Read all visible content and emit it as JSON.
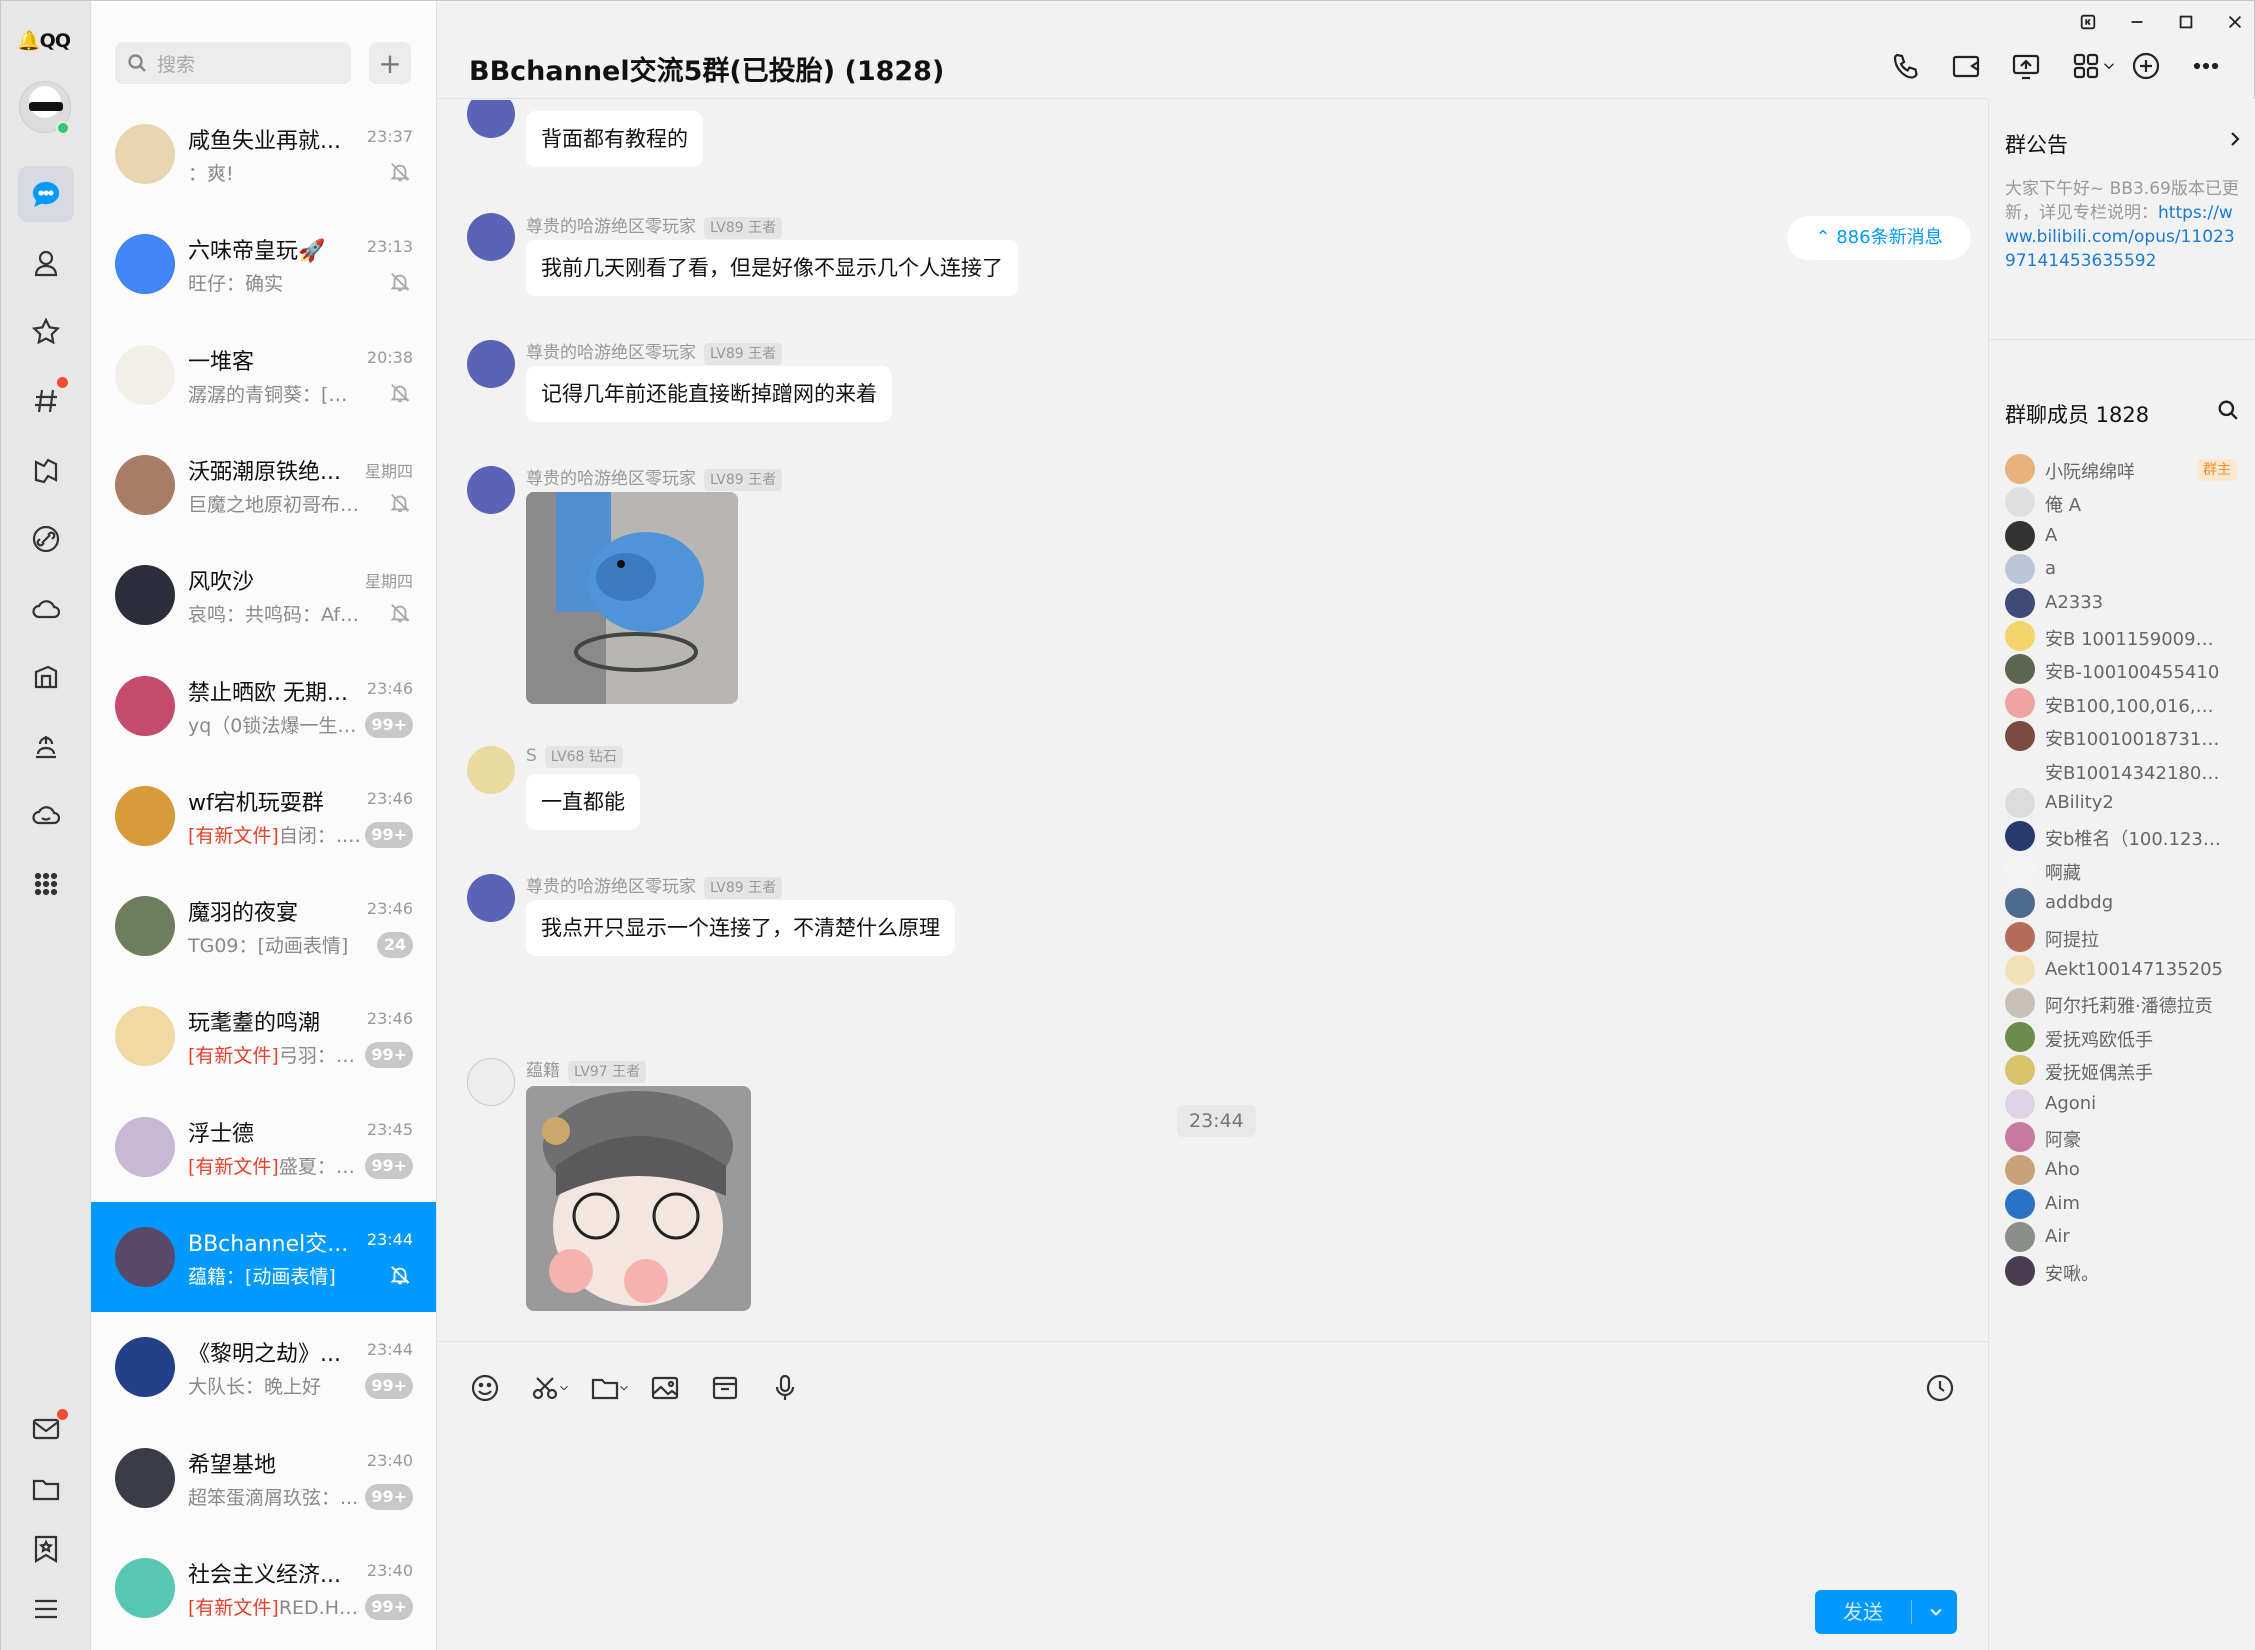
{
  "app": {
    "logo_text": "QQ"
  },
  "window_controls": [
    "pin-icon",
    "minimize-icon",
    "maximize-icon",
    "close-icon"
  ],
  "rail": {
    "items": [
      {
        "name": "chat-icon",
        "active": true
      },
      {
        "name": "contacts-icon"
      },
      {
        "name": "star-icon"
      },
      {
        "name": "channel-icon",
        "dot": true
      },
      {
        "name": "game-icon"
      },
      {
        "name": "link-icon"
      },
      {
        "name": "cloud-icon"
      },
      {
        "name": "bag-icon"
      },
      {
        "name": "music-icon"
      },
      {
        "name": "cloud-storage-icon"
      },
      {
        "name": "apps-grid-icon"
      }
    ],
    "bottom": [
      {
        "name": "mail-icon",
        "dot": true
      },
      {
        "name": "folder-icon"
      },
      {
        "name": "bookmark-icon"
      },
      {
        "name": "menu-icon"
      }
    ]
  },
  "search": {
    "placeholder": "搜索"
  },
  "conversations": [
    {
      "name": "咸鱼失业再就...",
      "time": "23:37",
      "preview": "：爽!",
      "muted": true,
      "avatar_color": "#e9d6b0"
    },
    {
      "name": "六味帝皇玩🚀",
      "time": "23:13",
      "preview": "旺仔：确实",
      "muted": true,
      "avatar_color": "#4285f4"
    },
    {
      "name": "一堆客",
      "time": "20:38",
      "preview": "潺潺的青铜葵：[图片]",
      "muted": true,
      "avatar_color": "#f1efe8"
    },
    {
      "name": "沃弼潮原铁绝...",
      "time": "星期四",
      "preview": "巨魔之地原初哥布林：...",
      "muted": true,
      "avatar_color": "#a87c65"
    },
    {
      "name": "风吹沙",
      "time": "星期四",
      "preview": "哀鸣：共鸣码：AfQiJA...",
      "muted": true,
      "avatar_color": "#2b2d3a"
    },
    {
      "name": "禁止晒欧  无期...",
      "time": "23:46",
      "preview": "yq（0锁法爆一生黑...",
      "badge": "99+",
      "avatar_color": "#c44b6b"
    },
    {
      "name": "wf宕机玩耍群",
      "time": "23:46",
      "tag": "[有新文件]",
      "preview": "自闭：.指...",
      "badge": "99+",
      "avatar_color": "#d99a3b"
    },
    {
      "name": "魔羽的夜宴",
      "time": "23:46",
      "preview": "TG09：[动画表情]",
      "badge": "24",
      "avatar_color": "#6d7d5e"
    },
    {
      "name": "玩耄耋的鸣潮",
      "time": "23:46",
      "tag": "[有新文件]",
      "preview": "弓羽：有...",
      "badge": "99+",
      "avatar_color": "#f0d9a2"
    },
    {
      "name": "浮士德",
      "time": "23:45",
      "tag": "[有新文件]",
      "preview": "盛夏：雀氏",
      "badge": "99+",
      "avatar_color": "#c9b7d6"
    },
    {
      "name": "BBchannel交...",
      "time": "23:44",
      "preview": "蕴籍：[动画表情]",
      "muted": true,
      "selected": true,
      "avatar_color": "#58496b"
    },
    {
      "name": "《黎明之劫》...",
      "time": "23:44",
      "preview": "大队长：晚上好",
      "badge": "99+",
      "avatar_color": "#23408a"
    },
    {
      "name": "希望基地",
      "time": "23:40",
      "preview": "超笨蛋滴屑玖弦：...",
      "badge": "99+",
      "avatar_color": "#3a3d48"
    },
    {
      "name": "社会主义经济...",
      "time": "23:40",
      "tag": "[有新文件]",
      "preview": "RED.HDL...",
      "badge": "99+",
      "avatar_color": "#58c6b5"
    }
  ],
  "chat": {
    "title": "BBchannel交流5群(已投胎) (1828)",
    "header_icons": [
      "phone-icon",
      "video-icon",
      "screen-share-icon",
      "apps-icon",
      "add-member-icon",
      "more-icon"
    ],
    "new_messages": "886条新消息",
    "messages": [
      {
        "sender": "",
        "level": "",
        "text": "背面都有教程的",
        "avatar_color": "#5a63b8"
      },
      {
        "sender": "尊贵的哈游绝区零玩家",
        "level": "LV89 王者",
        "text": "我前几天刚看了看，但是好像不显示几个人连接了",
        "avatar_color": "#5a63b8"
      },
      {
        "sender": "尊贵的哈游绝区零玩家",
        "level": "LV89 王者",
        "text": "记得几年前还能直接断掉蹭网的来着",
        "avatar_color": "#5a63b8"
      },
      {
        "sender": "尊贵的哈游绝区零玩家",
        "level": "LV89 王者",
        "image": "blue-plush-photo",
        "avatar_color": "#5a63b8"
      },
      {
        "sender": "S",
        "level": "LV68 钻石",
        "text": "一直都能",
        "avatar_color": "#e9dba0"
      },
      {
        "sender": "尊贵的哈游绝区零玩家",
        "level": "LV89 王者",
        "text": "我点开只显示一个连接了，不清楚什么原理",
        "avatar_color": "#5a63b8"
      },
      {
        "sender": "蕴籍",
        "level": "LV97 王者",
        "image": "anime-sticker",
        "avatar_color": "#eeeeee"
      }
    ],
    "time_separator": "23:44",
    "toolbar": [
      "emoji-icon",
      "scissors-icon",
      "folder-icon",
      "image-icon",
      "box-icon",
      "mic-icon"
    ],
    "history_icon": "clock-icon",
    "send_label": "发送"
  },
  "side": {
    "notice_title": "群公告",
    "notice_text": "大家下午好~ BB3.69版本已更新，详见专栏说明：",
    "notice_link": "https://www.bilibili.com/opus/1102397141453635592",
    "members_title": "群聊成员 1828",
    "owner_tag": "群主",
    "members": [
      {
        "name": "小阮绵绵咩",
        "color": "#e7b07c",
        "owner": true
      },
      {
        "name": "俺  A",
        "color": "#e0e0e0"
      },
      {
        "name": "A",
        "color": "#333333"
      },
      {
        "name": "a",
        "color": "#b9c7d8"
      },
      {
        "name": "A2333",
        "color": "#3f4a78"
      },
      {
        "name": "安B 100115900961 ...",
        "color": "#f3d36a"
      },
      {
        "name": "安B-100100455410",
        "color": "#5a6650"
      },
      {
        "name": "安B100,100,016,720",
        "color": "#f0a3a3"
      },
      {
        "name": "安B100100187317...",
        "color": "#7a4a3f"
      },
      {
        "name": "安B100143421800 ...",
        "color": "#f2f2f2"
      },
      {
        "name": "ABility2",
        "color": "#dcdcdc"
      },
      {
        "name": "安b椎名（100.123.8...",
        "color": "#283a6b"
      },
      {
        "name": "啊藏",
        "color": "#f4f4f4"
      },
      {
        "name": "addbdg",
        "color": "#4b6a8c"
      },
      {
        "name": "阿提拉",
        "color": "#b56b5a"
      },
      {
        "name": "Aekt100147135205",
        "color": "#f2e2b5"
      },
      {
        "name": "阿尔托莉雅·潘德拉贡",
        "color": "#c8c0b8"
      },
      {
        "name": "爱抚鸡欧低手",
        "color": "#6b8c4a"
      },
      {
        "name": "爱抚姬偶羔手",
        "color": "#d6c36a"
      },
      {
        "name": "Agoni",
        "color": "#dfd3e8"
      },
      {
        "name": "阿豪",
        "color": "#c87a9e"
      },
      {
        "name": "Aho",
        "color": "#c9a27a"
      },
      {
        "name": "Aim",
        "color": "#2a72c8"
      },
      {
        "name": "Air",
        "color": "#8a8f8a"
      },
      {
        "name": "安啾。",
        "color": "#4a3d52"
      }
    ]
  }
}
